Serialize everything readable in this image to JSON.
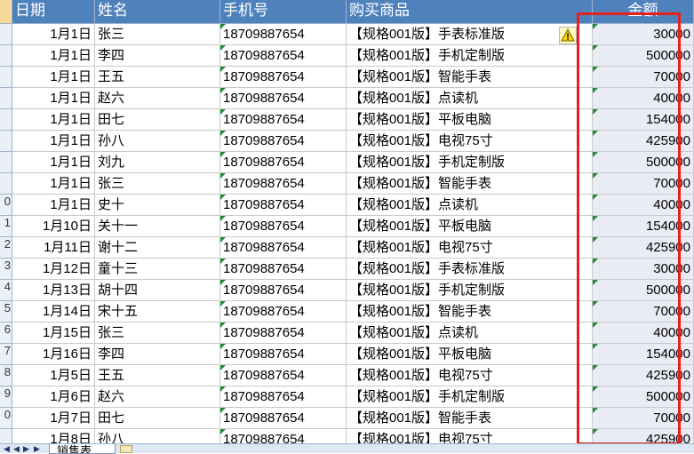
{
  "headers": {
    "date": "日期",
    "name": "姓名",
    "phone": "手机号",
    "product": "购买商品",
    "amount": "金额"
  },
  "rows": [
    {
      "num": "",
      "date": "1月1日",
      "name": "张三",
      "phone": "18709887654",
      "product": "【规格001版】手表标准版",
      "amount": "30000"
    },
    {
      "num": "",
      "date": "1月1日",
      "name": "李四",
      "phone": "18709887654",
      "product": "【规格001版】手机定制版",
      "amount": "500000"
    },
    {
      "num": "",
      "date": "1月1日",
      "name": "王五",
      "phone": "18709887654",
      "product": "【规格001版】智能手表",
      "amount": "70000"
    },
    {
      "num": "",
      "date": "1月1日",
      "name": "赵六",
      "phone": "18709887654",
      "product": "【规格001版】点读机",
      "amount": "40000"
    },
    {
      "num": "",
      "date": "1月1日",
      "name": "田七",
      "phone": "18709887654",
      "product": "【规格001版】平板电脑",
      "amount": "154000"
    },
    {
      "num": "",
      "date": "1月1日",
      "name": "孙八",
      "phone": "18709887654",
      "product": "【规格001版】电视75寸",
      "amount": "425900"
    },
    {
      "num": "",
      "date": "1月1日",
      "name": "刘九",
      "phone": "18709887654",
      "product": "【规格001版】手机定制版",
      "amount": "500000"
    },
    {
      "num": "",
      "date": "1月1日",
      "name": "张三",
      "phone": "18709887654",
      "product": "【规格001版】智能手表",
      "amount": "70000"
    },
    {
      "num": "0",
      "date": "1月1日",
      "name": "史十",
      "phone": "18709887654",
      "product": "【规格001版】点读机",
      "amount": "40000"
    },
    {
      "num": "1",
      "date": "1月10日",
      "name": "关十一",
      "phone": "18709887654",
      "product": "【规格001版】平板电脑",
      "amount": "154000"
    },
    {
      "num": "2",
      "date": "1月11日",
      "name": "谢十二",
      "phone": "18709887654",
      "product": "【规格001版】电视75寸",
      "amount": "425900"
    },
    {
      "num": "3",
      "date": "1月12日",
      "name": "童十三",
      "phone": "18709887654",
      "product": "【规格001版】手表标准版",
      "amount": "30000"
    },
    {
      "num": "4",
      "date": "1月13日",
      "name": "胡十四",
      "phone": "18709887654",
      "product": "【规格001版】手机定制版",
      "amount": "500000"
    },
    {
      "num": "5",
      "date": "1月14日",
      "name": "宋十五",
      "phone": "18709887654",
      "product": "【规格001版】智能手表",
      "amount": "70000"
    },
    {
      "num": "6",
      "date": "1月15日",
      "name": "张三",
      "phone": "18709887654",
      "product": "【规格001版】点读机",
      "amount": "40000"
    },
    {
      "num": "7",
      "date": "1月16日",
      "name": "李四",
      "phone": "18709887654",
      "product": "【规格001版】平板电脑",
      "amount": "154000"
    },
    {
      "num": "8",
      "date": "1月5日",
      "name": "王五",
      "phone": "18709887654",
      "product": "【规格001版】电视75寸",
      "amount": "425900"
    },
    {
      "num": "9",
      "date": "1月6日",
      "name": "赵六",
      "phone": "18709887654",
      "product": "【规格001版】手机定制版",
      "amount": "500000"
    },
    {
      "num": "0",
      "date": "1月7日",
      "name": "田七",
      "phone": "18709887654",
      "product": "【规格001版】智能手表",
      "amount": "70000"
    },
    {
      "num": "",
      "date": "1月8日",
      "name": "孙八",
      "phone": "18709887654",
      "product": "【规格001版】电视75寸",
      "amount": "425900"
    }
  ],
  "sheet_tab": "销售表",
  "colors": {
    "header_bg": "#4f81bd",
    "highlight": "#e8201c",
    "amount_bg": "#e9ecf4"
  }
}
